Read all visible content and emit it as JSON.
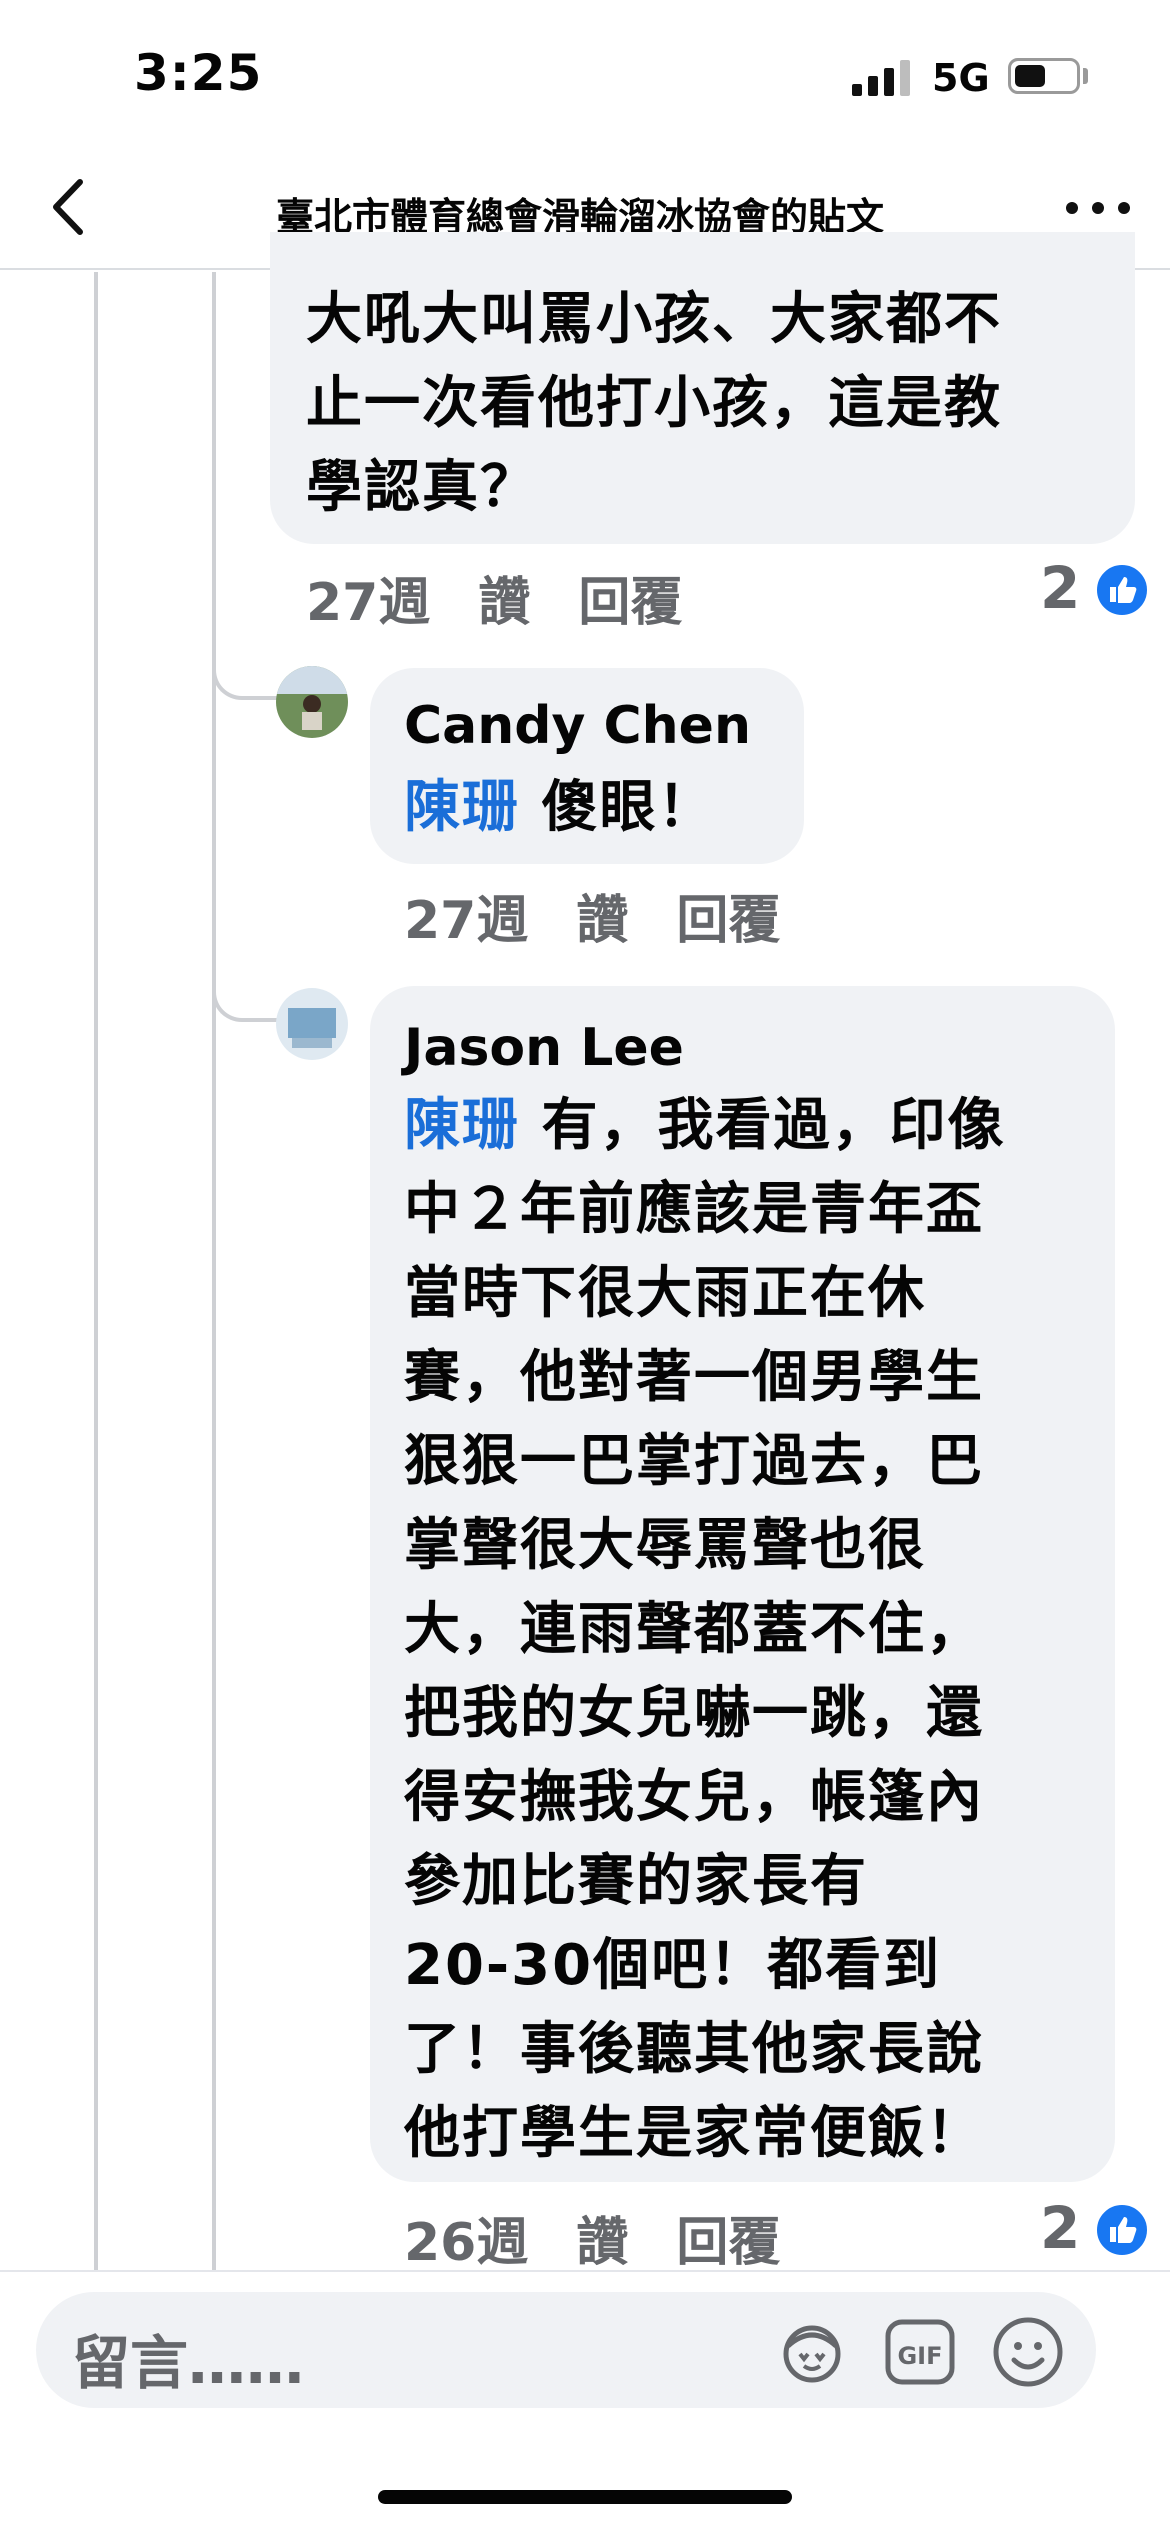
{
  "status": {
    "time": "3:25",
    "network": "5G"
  },
  "header": {
    "title": "臺北市體育總會滑輪溜冰協會的貼文"
  },
  "comments": [
    {
      "text_lines": [
        "大吼大叫罵小孩、大家都不",
        "止一次看他打小孩，這是教",
        "學認真？"
      ],
      "time": "27週",
      "like_label": "讚",
      "reply_label": "回覆",
      "reactions": "2"
    },
    {
      "author": "Candy Chen",
      "mention": "陳珊",
      "text": " 傻眼！",
      "time": "27週",
      "like_label": "讚",
      "reply_label": "回覆"
    },
    {
      "author": "Jason Lee",
      "mention": "陳珊",
      "first_line": " 有，我看過，印像",
      "text_lines": [
        "中２年前應該是青年盃",
        "當時下很大雨正在休",
        "賽，他對著一個男學生",
        "狠狠一巴掌打過去，巴",
        "掌聲很大辱罵聲也很",
        "大，連雨聲都蓋不住，",
        "把我的女兒嚇一跳，還",
        "得安撫我女兒，帳篷內",
        "參加比賽的家長有",
        " 20-30個吧！都看到",
        "了！事後聽其他家長說",
        "他打學生是家常便飯！"
      ],
      "time": "26週",
      "like_label": "讚",
      "reply_label": "回覆",
      "reactions": "2"
    }
  ],
  "composer": {
    "placeholder": "留言……"
  },
  "icons": [
    "back-icon",
    "more-icon",
    "like-icon",
    "avatar-sticker-icon",
    "gif-icon",
    "emoji-icon"
  ],
  "colors": {
    "mention": "#1a6ed8",
    "like": "#1877f2",
    "bubble": "#f0f2f5",
    "meta": "#65676b"
  }
}
